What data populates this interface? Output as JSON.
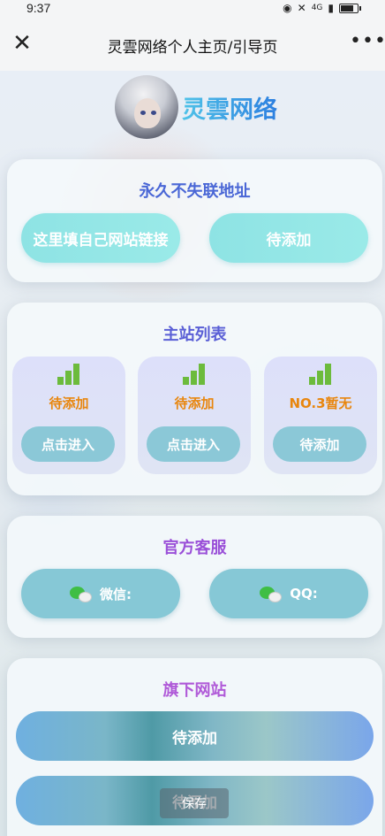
{
  "status_bar": {
    "time": "9:37",
    "network": "4G"
  },
  "title_bar": {
    "title": "灵雲网络个人主页/引导页",
    "close_symbol": "✕",
    "more_symbol": "•••"
  },
  "header": {
    "brand": "灵雲网络"
  },
  "permanent": {
    "title": "永久不失联地址",
    "button_left": "这里填自己网站链接",
    "button_right": "待添加"
  },
  "stations": {
    "title": "主站列表",
    "items": [
      {
        "label": "待添加",
        "button": "点击进入"
      },
      {
        "label": "待添加",
        "button": "点击进入"
      },
      {
        "label": "NO.3暂无",
        "button": "待添加"
      }
    ]
  },
  "service": {
    "title": "官方客服",
    "wechat": "微信:",
    "qq": "QQ:"
  },
  "sites": {
    "title": "旗下网站",
    "items": [
      "待添加",
      "待添加"
    ]
  },
  "save_button": "保存",
  "colors": {
    "permanent_title": "#4a67d6",
    "stations_title": "#5a5fd6",
    "service_title": "#9a4fd8",
    "sites_title": "#b05ad8",
    "tile_label": "#e8860e"
  }
}
